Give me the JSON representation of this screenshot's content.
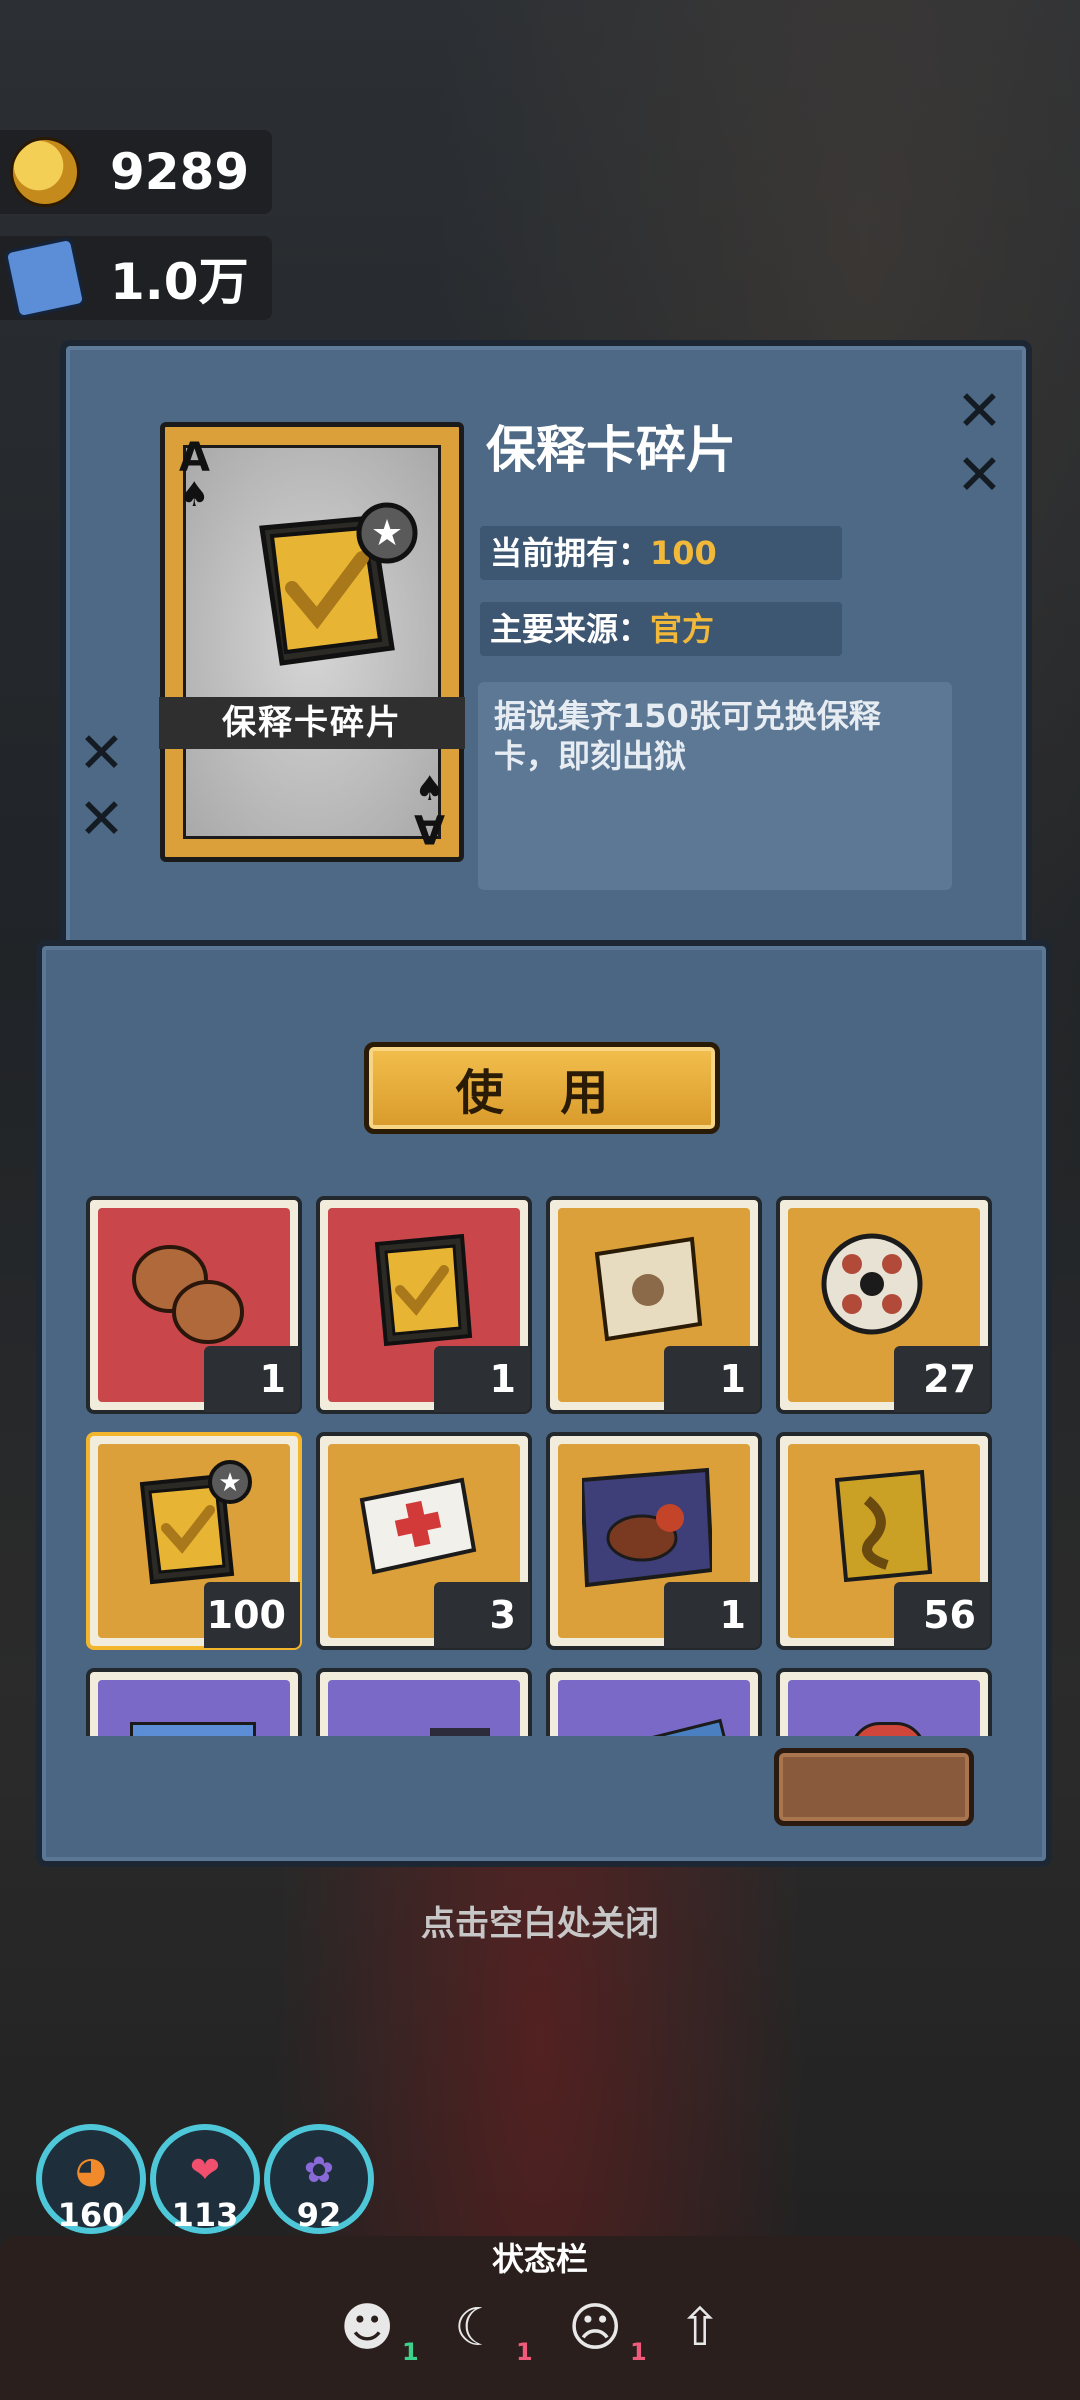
{
  "currencies": [
    {
      "icon": "gold-coin-icon",
      "value": "9289"
    },
    {
      "icon": "ticket-icon",
      "value": "1.0万"
    }
  ],
  "detail": {
    "card_rank": "A",
    "card_suit": "♠",
    "card_label": "保释卡碎片",
    "title": "保释卡碎片",
    "owned_label": "当前拥有：",
    "owned_value": "100",
    "source_label": "主要来源：",
    "source_value": "官方",
    "description": "据说集齐150张可兑换保释卡，即刻出狱"
  },
  "use_button": "使 用",
  "inventory": [
    {
      "name": "walnuts",
      "count": "1",
      "color": "#c9474a"
    },
    {
      "name": "bail-card",
      "count": "1",
      "color": "#c9474a"
    },
    {
      "name": "treasure-map",
      "count": "1",
      "color": "#dba03a"
    },
    {
      "name": "film-reel",
      "count": "27",
      "color": "#dba03a"
    },
    {
      "name": "bail-card-fragment",
      "count": "100",
      "color": "#dba03a",
      "selected": true
    },
    {
      "name": "medical-card",
      "count": "3",
      "color": "#dba03a"
    },
    {
      "name": "steak-meal",
      "count": "1",
      "color": "#dba03a"
    },
    {
      "name": "golden-ribbon-card",
      "count": "56",
      "color": "#dba03a"
    },
    {
      "name": "blue-ticket",
      "count": "",
      "color": "#7b69c7"
    },
    {
      "name": "purple-item",
      "count": "",
      "color": "#7b69c7"
    },
    {
      "name": "blue-card",
      "count": "",
      "color": "#7b69c7"
    },
    {
      "name": "red-item",
      "count": "",
      "color": "#7b69c7"
    }
  ],
  "close_hint": "点击空白处关闭",
  "stats": [
    {
      "icon": "hunger-icon",
      "value": "160"
    },
    {
      "icon": "heart-icon",
      "value": "113"
    },
    {
      "icon": "brain-icon",
      "value": "92"
    }
  ],
  "statusbar": {
    "title": "状态栏",
    "items": [
      {
        "icon": "mood-icon",
        "count": "1"
      },
      {
        "icon": "sleep-icon",
        "count": "1"
      },
      {
        "icon": "mask-icon",
        "count": "1"
      },
      {
        "icon": "upgrade-icon",
        "count": ""
      }
    ]
  }
}
